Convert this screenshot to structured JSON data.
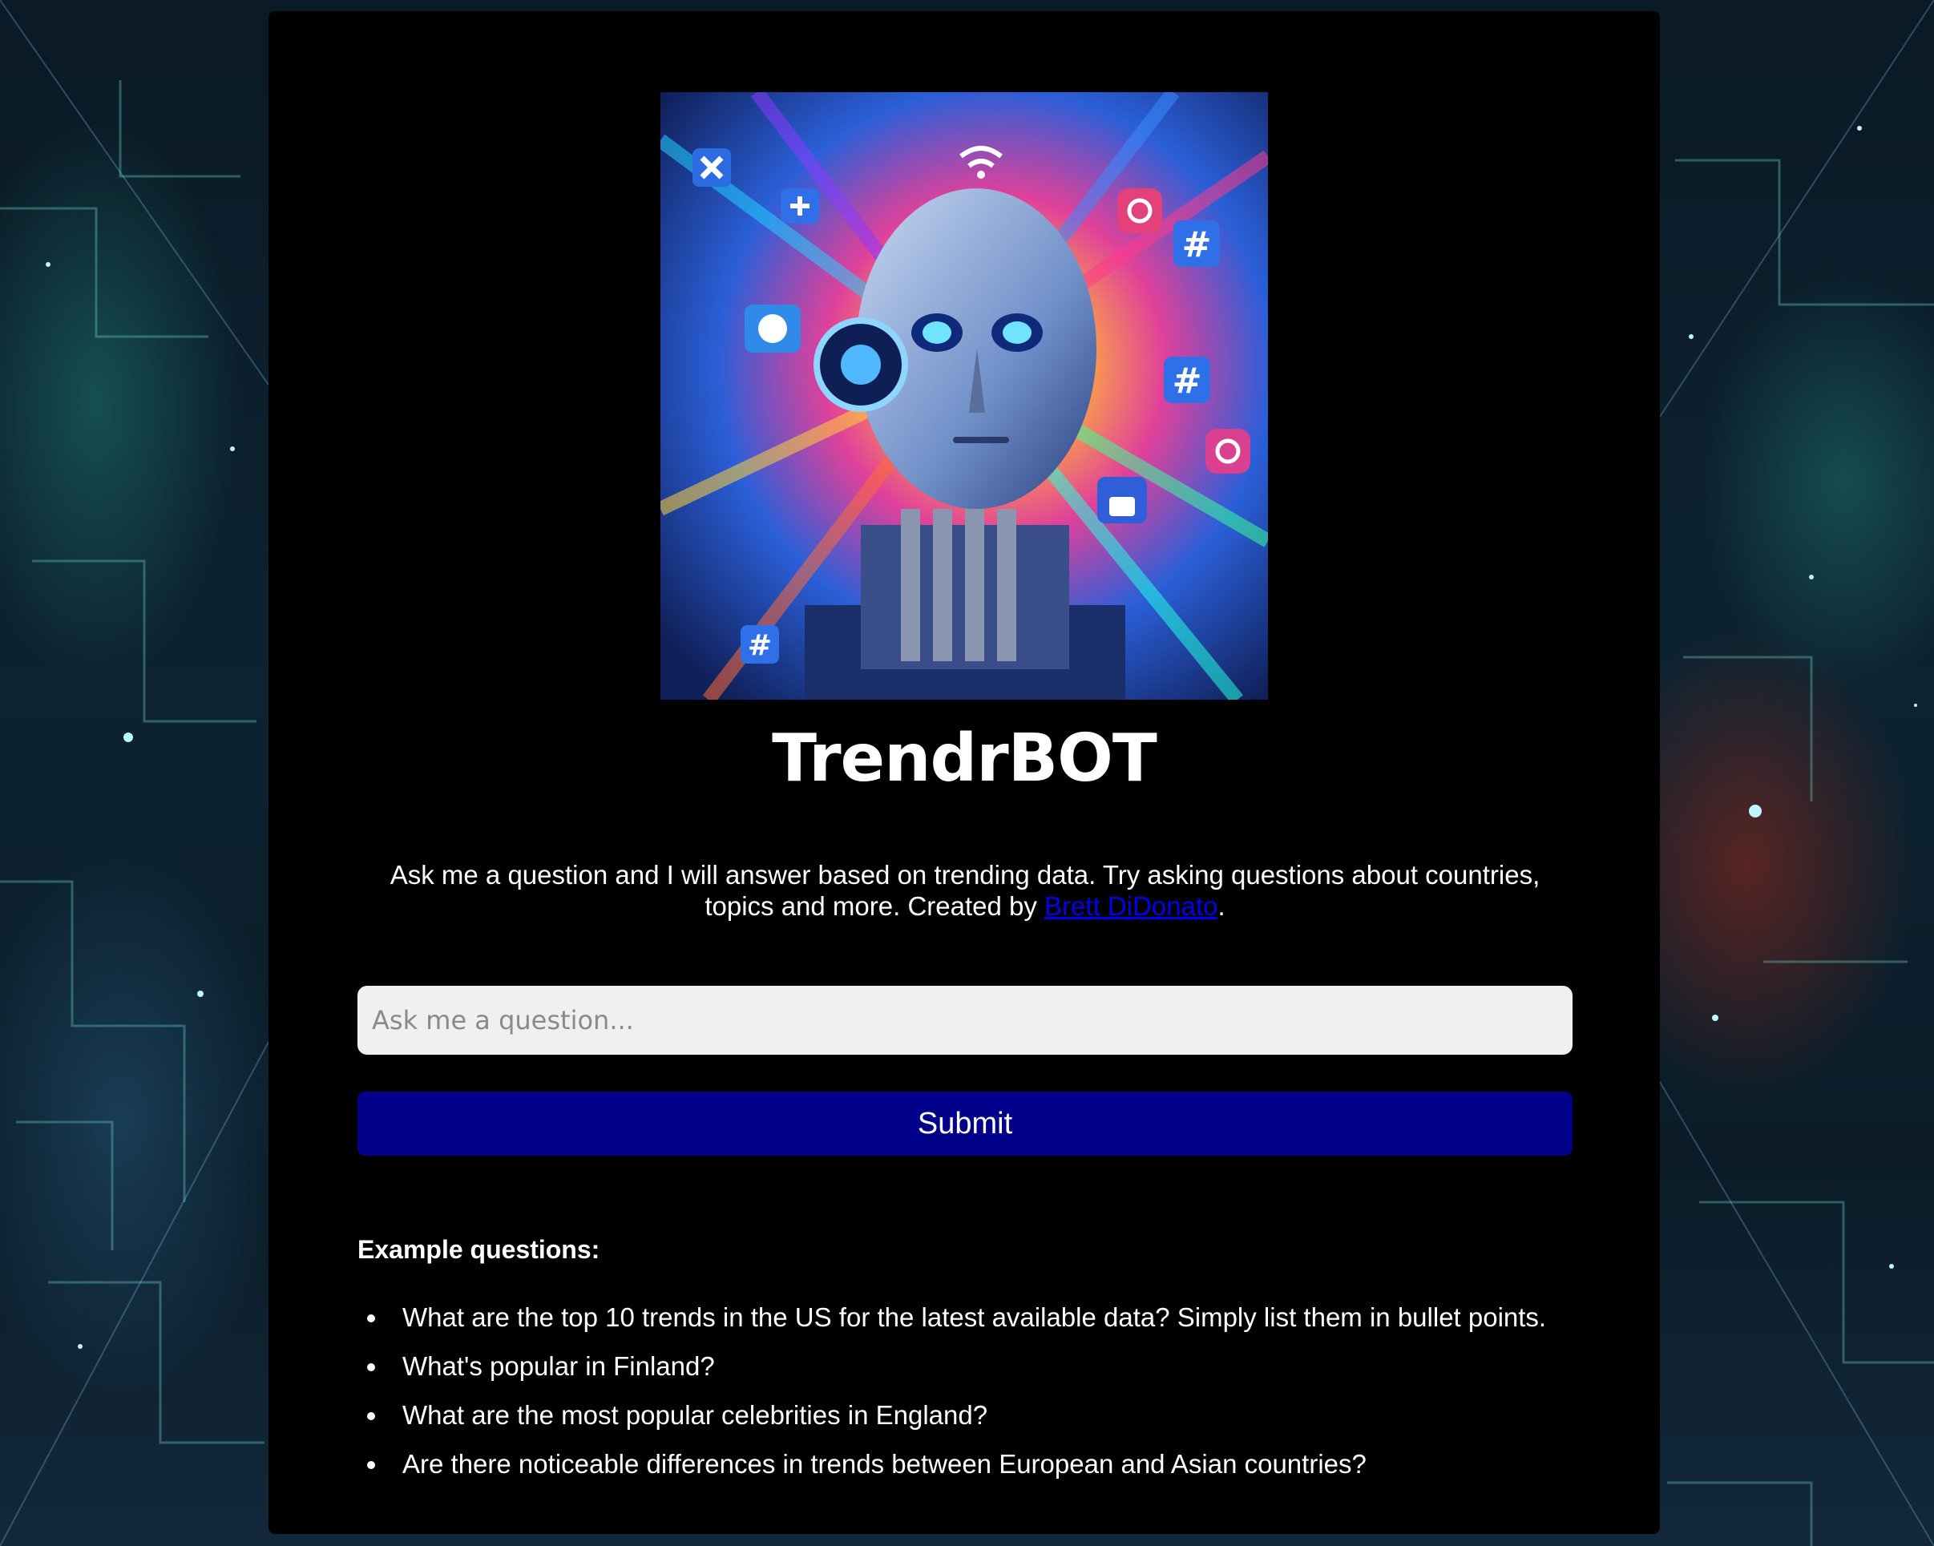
{
  "app": {
    "title": "TrendrBOT"
  },
  "intro": {
    "text_before_link": "Ask me a question and I will answer based on trending data. Try asking questions about countries, topics and more. Created by ",
    "author_link": "Brett DiDonato",
    "text_after_link": "."
  },
  "form": {
    "placeholder": "Ask me a question...",
    "value": "",
    "submit_label": "Submit"
  },
  "examples": {
    "heading": "Example questions:",
    "items": [
      "What are the top 10 trends in the US for the latest available data? Simply list them in bullet points.",
      "What's popular in Finland?",
      "What are the most popular celebrities in England?",
      "Are there noticeable differences in trends between European and Asian countries?"
    ]
  },
  "hero_icons": [
    "x-icon",
    "twitter-icon",
    "wifi-icon",
    "instagram-icon",
    "hashtag-icon",
    "thumbs-up-icon",
    "plus-icon"
  ],
  "colors": {
    "panel_background": "#000000",
    "submit_background": "#00008b",
    "input_background": "#f0f0f3",
    "link": "#0000ee",
    "text": "#ffffff"
  }
}
